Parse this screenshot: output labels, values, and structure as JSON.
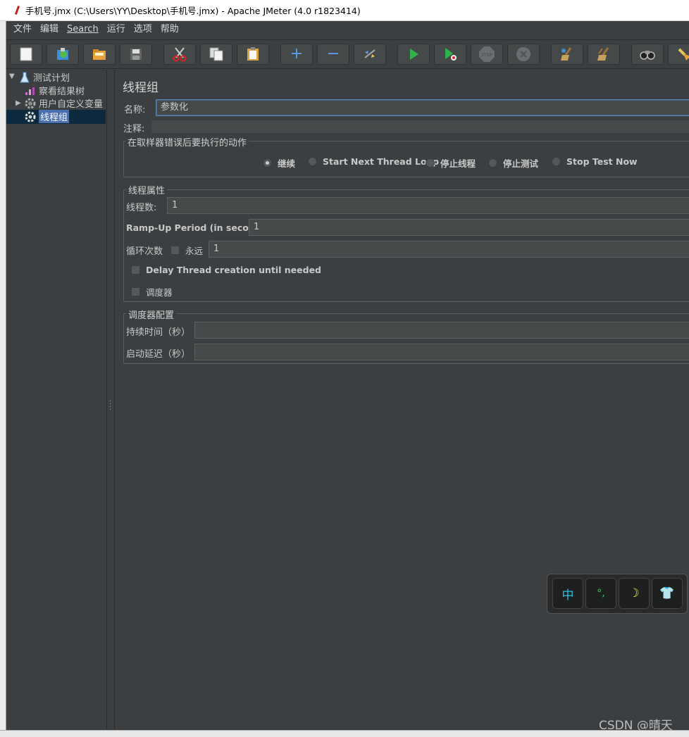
{
  "window": {
    "title": "手机号.jmx (C:\\Users\\YY\\Desktop\\手机号.jmx) - Apache JMeter (4.0 r1823414)"
  },
  "menu": [
    "文件",
    "编辑",
    "Search",
    "运行",
    "选项",
    "帮助"
  ],
  "toolbar": {
    "buttons": [
      {
        "icon": "new-icon"
      },
      {
        "icon": "templates-icon"
      },
      {
        "icon": "open-icon"
      },
      {
        "icon": "save-icon"
      },
      {
        "icon": "cut-icon"
      },
      {
        "icon": "copy-icon"
      },
      {
        "icon": "paste-icon"
      },
      {
        "icon": "expand-icon"
      },
      {
        "icon": "collapse-icon"
      },
      {
        "icon": "toggle-icon"
      },
      {
        "icon": "start-icon"
      },
      {
        "icon": "start-no-pause-icon"
      },
      {
        "icon": "stop-icon"
      },
      {
        "icon": "shutdown-icon"
      },
      {
        "icon": "clear-icon"
      },
      {
        "icon": "clear-all-icon"
      },
      {
        "icon": "search-icon"
      },
      {
        "icon": "reset-search-icon"
      }
    ],
    "stop_label": "STOP"
  },
  "tree": {
    "items": [
      {
        "label": "测试计划",
        "icon": "flask-icon"
      },
      {
        "label": "察看结果树",
        "icon": "chart-icon"
      },
      {
        "label": "用户自定义变量",
        "icon": "gear-icon"
      },
      {
        "label": "线程组",
        "icon": "gear-icon"
      }
    ]
  },
  "panel": {
    "title": "线程组",
    "name_label": "名称:",
    "name_value": "参数化",
    "comment_label": "注释:",
    "comment_value": "",
    "error_action": {
      "legend": "在取样器错误后要执行的动作",
      "options": [
        "继续",
        "Start Next Thread Loop",
        "停止线程",
        "停止测试",
        "Stop Test Now"
      ],
      "selected": "继续"
    },
    "thread_props": {
      "legend": "线程属性",
      "threads_label": "线程数:",
      "threads_value": "1",
      "rampup_label": "Ramp-Up Period (in seconds):",
      "rampup_value": "1",
      "loop_label": "循环次数",
      "forever_label": "永远",
      "loop_value": "1",
      "delay_label": "Delay Thread creation until needed",
      "scheduler_label": "调度器"
    },
    "scheduler_config": {
      "legend": "调度器配置",
      "duration_label": "持续时间（秒）",
      "duration_value": "",
      "delay_label": "启动延迟（秒）",
      "delay_value": ""
    }
  },
  "ime": {
    "keys": [
      "中",
      "°,",
      "☽",
      "👕"
    ]
  },
  "watermark": "CSDN @晴天"
}
